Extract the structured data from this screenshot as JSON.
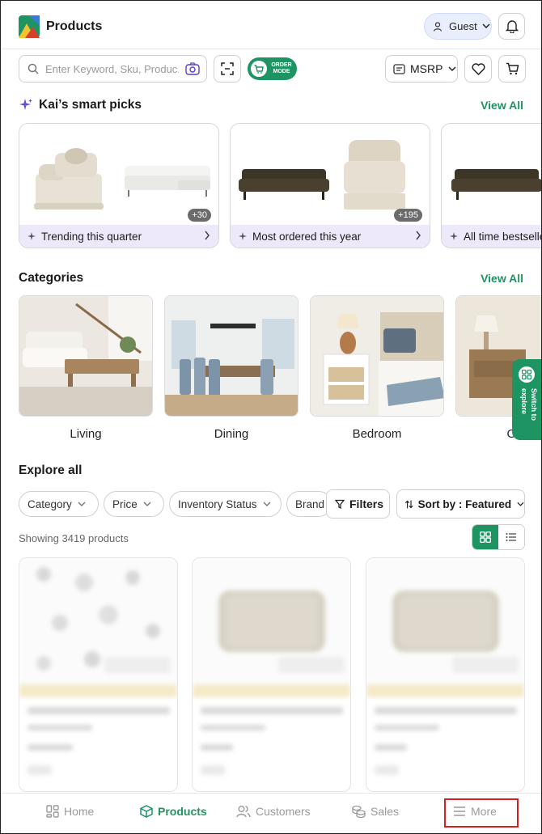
{
  "header": {
    "title": "Products",
    "user_label": "Guest"
  },
  "toolbar": {
    "search_placeholder": "Enter Keyword, Sku, Produc...",
    "order_mode_label": "ORDER\nMODE",
    "price_mode": "MSRP"
  },
  "smart_picks": {
    "title": "Kai’s smart picks",
    "view_all": "View All",
    "cards": [
      {
        "label": "Trending this quarter",
        "count": "+30"
      },
      {
        "label": "Most ordered this year",
        "count": "+195"
      },
      {
        "label": "All time bestsellers",
        "count": ""
      }
    ]
  },
  "categories": {
    "title": "Categories",
    "view_all": "View All",
    "items": [
      {
        "label": "Living"
      },
      {
        "label": "Dining"
      },
      {
        "label": "Bedroom"
      },
      {
        "label": "Office"
      }
    ]
  },
  "switch_explore": {
    "label": "Switch to explore"
  },
  "explore": {
    "title": "Explore all",
    "chips": [
      "Category",
      "Price",
      "Inventory Status",
      "Brand"
    ],
    "filters_label": "Filters",
    "sort_label": "Sort by : Featured",
    "showing": "Showing 3419 products"
  },
  "bottom_nav": {
    "items": [
      {
        "label": "Home"
      },
      {
        "label": "Products"
      },
      {
        "label": "Customers"
      },
      {
        "label": "Sales"
      },
      {
        "label": "More"
      }
    ]
  },
  "colors": {
    "accent": "#1f9463",
    "smart_pick_band": "#ede9fb",
    "highlight_border": "#d62020"
  }
}
